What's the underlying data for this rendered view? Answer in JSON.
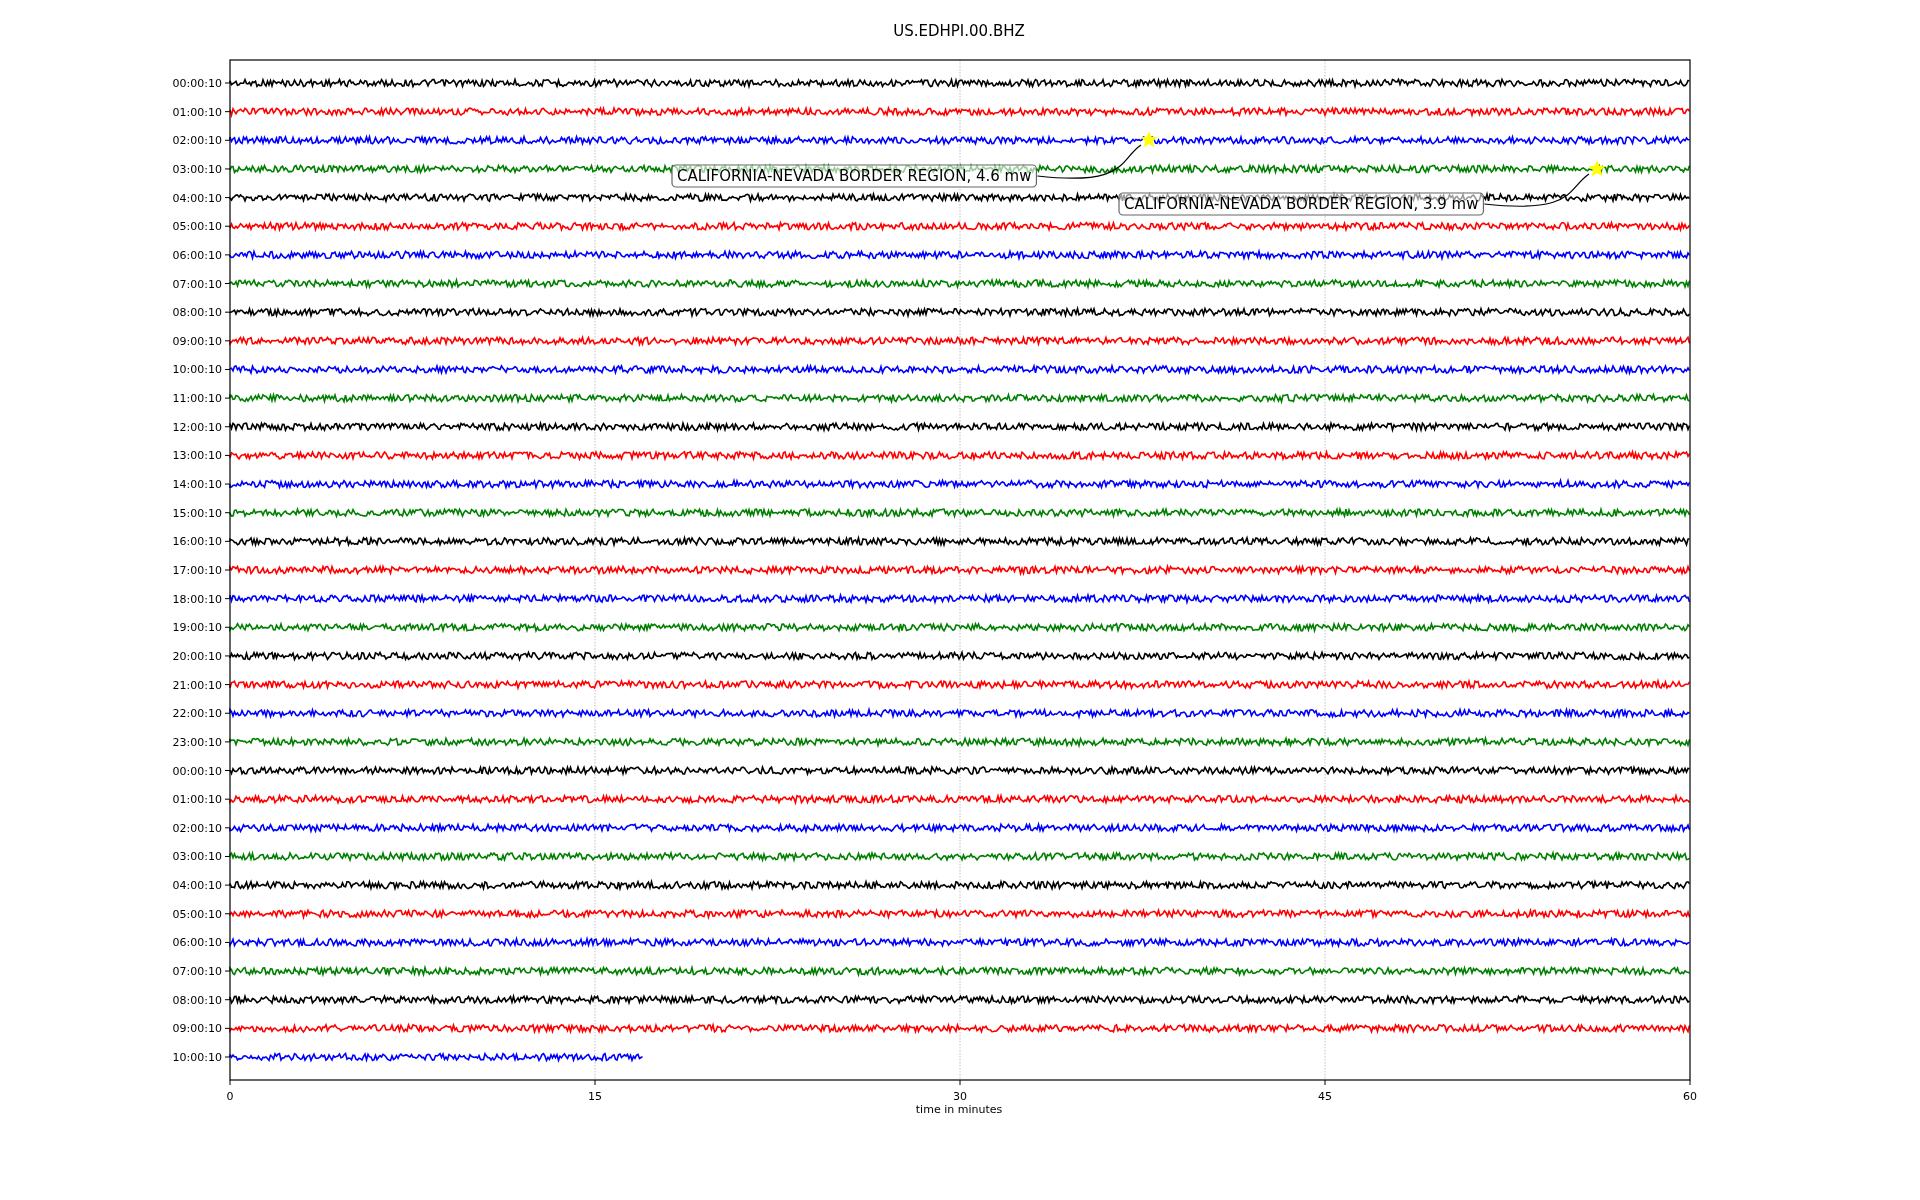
{
  "title": "US.EDHPI.00.BHZ",
  "xlabel": "time in minutes",
  "xticks": [
    "0",
    "15",
    "30",
    "45",
    "60"
  ],
  "traces": [
    {
      "label": "00:00:10",
      "color": "#000000",
      "level": 1
    },
    {
      "label": "01:00:10",
      "color": "#ff0000",
      "level": 1
    },
    {
      "label": "02:00:10",
      "color": "#0000ff",
      "level": 1
    },
    {
      "label": "03:00:10",
      "color": "#008000",
      "level": 1
    },
    {
      "label": "04:00:10",
      "color": "#000000",
      "level": 1
    },
    {
      "label": "05:00:10",
      "color": "#ff0000",
      "level": 1
    },
    {
      "label": "06:00:10",
      "color": "#0000ff",
      "level": 1
    },
    {
      "label": "07:00:10",
      "color": "#008000",
      "level": 1
    },
    {
      "label": "08:00:10",
      "color": "#000000",
      "level": 1
    },
    {
      "label": "09:00:10",
      "color": "#ff0000",
      "level": 1
    },
    {
      "label": "10:00:10",
      "color": "#0000ff",
      "level": 1
    },
    {
      "label": "11:00:10",
      "color": "#008000",
      "level": 1
    },
    {
      "label": "12:00:10",
      "color": "#000000",
      "level": 1
    },
    {
      "label": "13:00:10",
      "color": "#ff0000",
      "level": 1
    },
    {
      "label": "14:00:10",
      "color": "#0000ff",
      "level": 1
    },
    {
      "label": "15:00:10",
      "color": "#008000",
      "level": 1
    },
    {
      "label": "16:00:10",
      "color": "#000000",
      "level": 1
    },
    {
      "label": "17:00:10",
      "color": "#ff0000",
      "level": 1
    },
    {
      "label": "18:00:10",
      "color": "#0000ff",
      "level": 1
    },
    {
      "label": "19:00:10",
      "color": "#008000",
      "level": 1
    },
    {
      "label": "20:00:10",
      "color": "#000000",
      "level": 1
    },
    {
      "label": "21:00:10",
      "color": "#ff0000",
      "level": 1
    },
    {
      "label": "22:00:10",
      "color": "#0000ff",
      "level": 1
    },
    {
      "label": "23:00:10",
      "color": "#008000",
      "level": 1
    },
    {
      "label": "00:00:10",
      "color": "#000000",
      "level": 1
    },
    {
      "label": "01:00:10",
      "color": "#ff0000",
      "level": 1
    },
    {
      "label": "02:00:10",
      "color": "#0000ff",
      "level": 1
    },
    {
      "label": "03:00:10",
      "color": "#008000",
      "level": 1
    },
    {
      "label": "04:00:10",
      "color": "#000000",
      "level": 1
    },
    {
      "label": "05:00:10",
      "color": "#ff0000",
      "level": 1
    },
    {
      "label": "06:00:10",
      "color": "#0000ff",
      "level": 1
    },
    {
      "label": "07:00:10",
      "color": "#008000",
      "level": 1
    },
    {
      "label": "08:00:10",
      "color": "#000000",
      "level": 1
    },
    {
      "label": "09:00:10",
      "color": "#ff0000",
      "level": 1
    },
    {
      "label": "10:00:10",
      "color": "#0000ff",
      "level": 0.283
    }
  ],
  "events": [
    {
      "label": "CALIFORNIA-NEVADA BORDER REGION, 4.6 mw"
    },
    {
      "label": "CALIFORNIA-NEVADA BORDER REGION, 3.9 mw"
    }
  ]
}
